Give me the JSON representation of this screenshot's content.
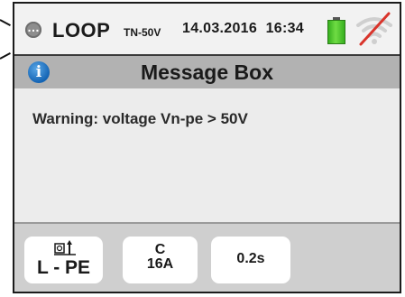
{
  "status_bar": {
    "function_name": "LOOP",
    "function_subtype": "TN-50V",
    "date": "14.03.2016",
    "time": "16:34",
    "battery_color": "#37b01f",
    "icons": [
      "status-dot-icon",
      "battery-icon",
      "wifi-disabled-icon"
    ]
  },
  "title_bar": {
    "icon": "info-icon",
    "icon_glyph": "i",
    "title": "Message Box"
  },
  "message": {
    "text": "Warning: voltage Vn-pe > 50V"
  },
  "parameters": {
    "mode": {
      "icon": "socket-probe-icon",
      "label": "L - PE"
    },
    "protection": {
      "curve": "C",
      "current": "16A"
    },
    "trip_time": {
      "label": "0.2s"
    }
  },
  "colors": {
    "title_bar_bg": "#b2b2b2",
    "info_icon": "#1464b4",
    "wifi_slash": "#d9342b"
  }
}
